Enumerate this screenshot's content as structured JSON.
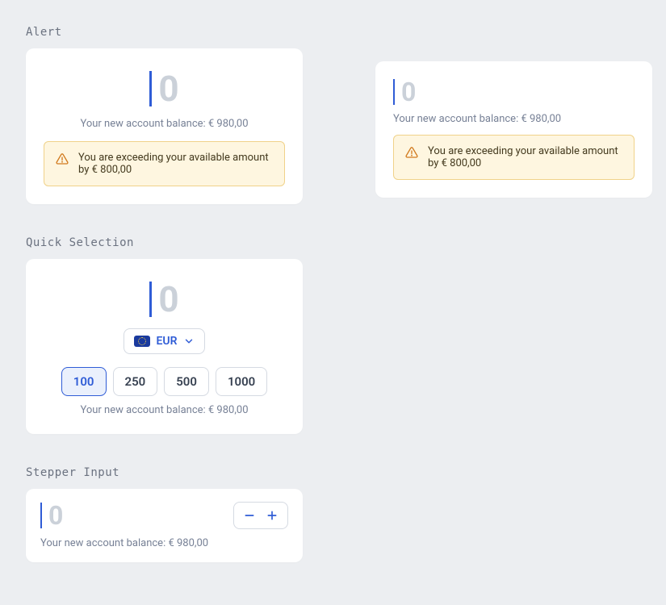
{
  "sections": {
    "alert_label": "Alert",
    "quick_label": "Quick Selection",
    "stepper_label": "Stepper Input"
  },
  "amount_placeholder": "0",
  "balance": {
    "prefix": "Your new account balance: ",
    "value": "€ 980,00"
  },
  "warning": {
    "text_prefix": "You are exceeding your available amount by ",
    "value": "€ 800,00"
  },
  "currency": {
    "code": "EUR"
  },
  "quick_amounts": {
    "selected_index": 0,
    "options": [
      "100",
      "250",
      "500",
      "1000"
    ]
  }
}
